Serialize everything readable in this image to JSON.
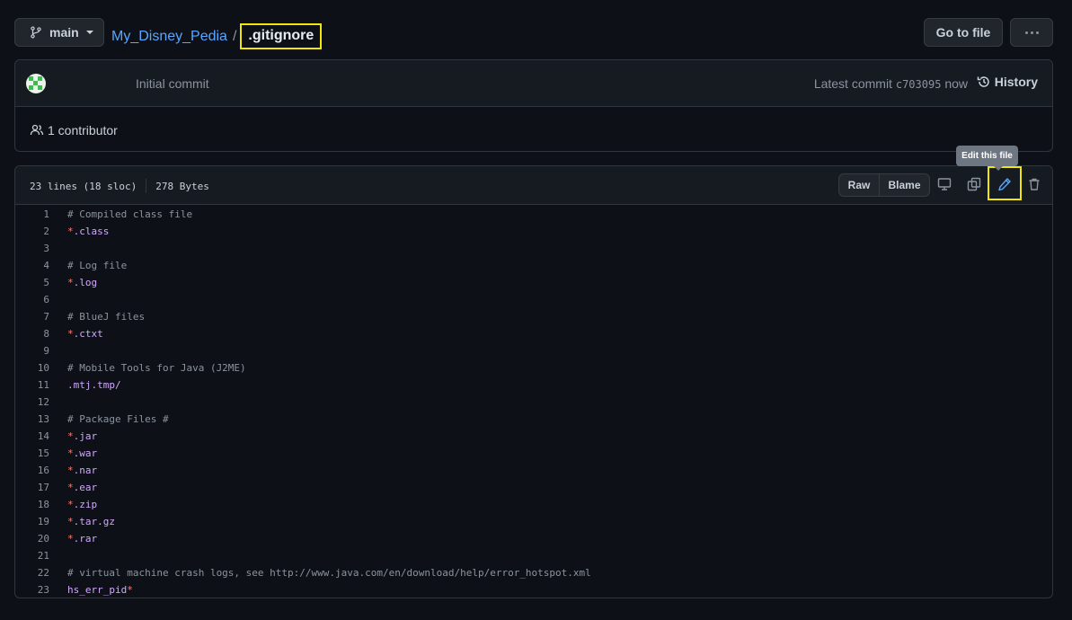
{
  "branch": {
    "name": "main"
  },
  "breadcrumb": {
    "repo": "My_Disney_Pedia",
    "separator": "/",
    "file": ".gitignore"
  },
  "header_buttons": {
    "go_to_file": "Go to file"
  },
  "commit": {
    "message": "Initial commit",
    "latest_label": "Latest commit",
    "sha": "c703095",
    "time": "now",
    "history_label": "History"
  },
  "contributors": {
    "label": "1 contributor"
  },
  "file": {
    "lines_info": "23 lines (18 sloc)",
    "size": "278 Bytes",
    "raw_label": "Raw",
    "blame_label": "Blame",
    "tooltip": "Edit this file"
  },
  "colors": {
    "highlight": "#f1e60b",
    "link": "#58a6ff",
    "background": "#0d1117"
  },
  "icons": [
    "git-branch-icon",
    "history-icon",
    "people-icon",
    "display-icon",
    "copy-icon",
    "pencil-icon",
    "trash-icon"
  ],
  "code_lines": [
    {
      "n": "1",
      "tokens": [
        {
          "t": "# Compiled class file",
          "c": "comment"
        }
      ]
    },
    {
      "n": "2",
      "tokens": [
        {
          "t": "*",
          "c": "star"
        },
        {
          "t": ".class",
          "c": "text"
        }
      ]
    },
    {
      "n": "3",
      "tokens": []
    },
    {
      "n": "4",
      "tokens": [
        {
          "t": "# Log file",
          "c": "comment"
        }
      ]
    },
    {
      "n": "5",
      "tokens": [
        {
          "t": "*",
          "c": "star"
        },
        {
          "t": ".log",
          "c": "text"
        }
      ]
    },
    {
      "n": "6",
      "tokens": []
    },
    {
      "n": "7",
      "tokens": [
        {
          "t": "# BlueJ files",
          "c": "comment"
        }
      ]
    },
    {
      "n": "8",
      "tokens": [
        {
          "t": "*",
          "c": "star"
        },
        {
          "t": ".ctxt",
          "c": "text"
        }
      ]
    },
    {
      "n": "9",
      "tokens": []
    },
    {
      "n": "10",
      "tokens": [
        {
          "t": "# Mobile Tools for Java (J2ME)",
          "c": "comment"
        }
      ]
    },
    {
      "n": "11",
      "tokens": [
        {
          "t": ".mtj.tmp/",
          "c": "text"
        }
      ]
    },
    {
      "n": "12",
      "tokens": []
    },
    {
      "n": "13",
      "tokens": [
        {
          "t": "# Package Files #",
          "c": "comment"
        }
      ]
    },
    {
      "n": "14",
      "tokens": [
        {
          "t": "*",
          "c": "star"
        },
        {
          "t": ".jar",
          "c": "text"
        }
      ]
    },
    {
      "n": "15",
      "tokens": [
        {
          "t": "*",
          "c": "star"
        },
        {
          "t": ".war",
          "c": "text"
        }
      ]
    },
    {
      "n": "16",
      "tokens": [
        {
          "t": "*",
          "c": "star"
        },
        {
          "t": ".nar",
          "c": "text"
        }
      ]
    },
    {
      "n": "17",
      "tokens": [
        {
          "t": "*",
          "c": "star"
        },
        {
          "t": ".ear",
          "c": "text"
        }
      ]
    },
    {
      "n": "18",
      "tokens": [
        {
          "t": "*",
          "c": "star"
        },
        {
          "t": ".zip",
          "c": "text"
        }
      ]
    },
    {
      "n": "19",
      "tokens": [
        {
          "t": "*",
          "c": "star"
        },
        {
          "t": ".tar.gz",
          "c": "text"
        }
      ]
    },
    {
      "n": "20",
      "tokens": [
        {
          "t": "*",
          "c": "star"
        },
        {
          "t": ".rar",
          "c": "text"
        }
      ]
    },
    {
      "n": "21",
      "tokens": []
    },
    {
      "n": "22",
      "tokens": [
        {
          "t": "# virtual machine crash logs, see http://www.java.com/en/download/help/error_hotspot.xml",
          "c": "comment"
        }
      ]
    },
    {
      "n": "23",
      "tokens": [
        {
          "t": "hs_err_pid",
          "c": "text"
        },
        {
          "t": "*",
          "c": "star"
        }
      ]
    }
  ]
}
